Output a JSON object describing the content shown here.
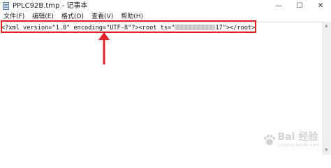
{
  "window": {
    "title": "PPLC92B.tmp - 记事本",
    "minimize_glyph": "—",
    "maximize_glyph": "☐",
    "close_glyph": "✕"
  },
  "menu": {
    "items": [
      {
        "label": "文件(F)"
      },
      {
        "label": "编辑(E)"
      },
      {
        "label": "格式(O)"
      },
      {
        "label": "查看(V)"
      },
      {
        "label": "帮助(H)"
      }
    ]
  },
  "editor": {
    "line_prefix": "<?xml version=\"1.0\" encoding=\"UTF-8\"?><root ts=\"",
    "line_suffix": "17\"></root>"
  },
  "annotation": {
    "highlight_color": "#e1242b",
    "arrow_color": "#e1242b"
  },
  "watermark": {
    "text": "Bai 经验",
    "subtext": "jingyan.baidu.com"
  }
}
